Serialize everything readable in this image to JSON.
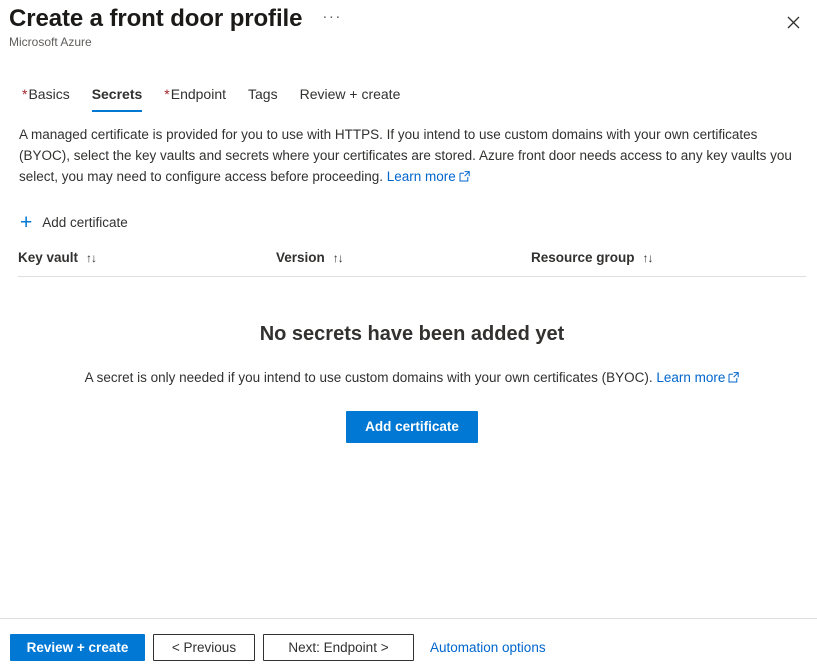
{
  "header": {
    "title": "Create a front door profile",
    "subtitle": "Microsoft Azure",
    "more_label": "···",
    "close_label": "Close",
    "close_icon": "close-icon",
    "more_icon": "ellipsis-icon"
  },
  "tabs": [
    {
      "label": "Basics",
      "required": true,
      "active": false
    },
    {
      "label": "Secrets",
      "required": false,
      "active": true
    },
    {
      "label": "Endpoint",
      "required": true,
      "active": false
    },
    {
      "label": "Tags",
      "required": false,
      "active": false
    },
    {
      "label": "Review + create",
      "required": false,
      "active": false
    }
  ],
  "description": {
    "text_part1": "A managed certificate is provided for you to use with HTTPS. If you intend to use custom domains with your own certificates (BYOC), select the key vaults and secrets where your certificates are stored. Azure front door needs access to any key vaults you select, you may need to configure access before proceeding.",
    "learn_more_label": "Learn more",
    "external_icon": "external-link-icon"
  },
  "command_bar": {
    "add_certificate_label": "Add certificate",
    "add_icon": "plus-icon"
  },
  "table": {
    "columns": [
      {
        "label": "Key vault",
        "sort_icon": "↑↓"
      },
      {
        "label": "Version",
        "sort_icon": "↑↓"
      },
      {
        "label": "Resource group",
        "sort_icon": "↑↓"
      }
    ],
    "rows": []
  },
  "empty_state": {
    "title": "No secrets have been added yet",
    "message": "A secret is only needed if you intend to use custom domains with your own certificates (BYOC).",
    "learn_more_label": "Learn more",
    "external_icon": "external-link-icon",
    "button_label": "Add certificate"
  },
  "footer": {
    "review_create_label": "Review + create",
    "previous_label": "< Previous",
    "next_label": "Next: Endpoint >",
    "automation_label": "Automation options"
  },
  "colors": {
    "accent": "#0078d4",
    "link": "#0066cc",
    "required_asterisk": "#a4262c",
    "text": "#323130",
    "subtle_text": "#605e5c",
    "border": "#e1dfdd"
  }
}
